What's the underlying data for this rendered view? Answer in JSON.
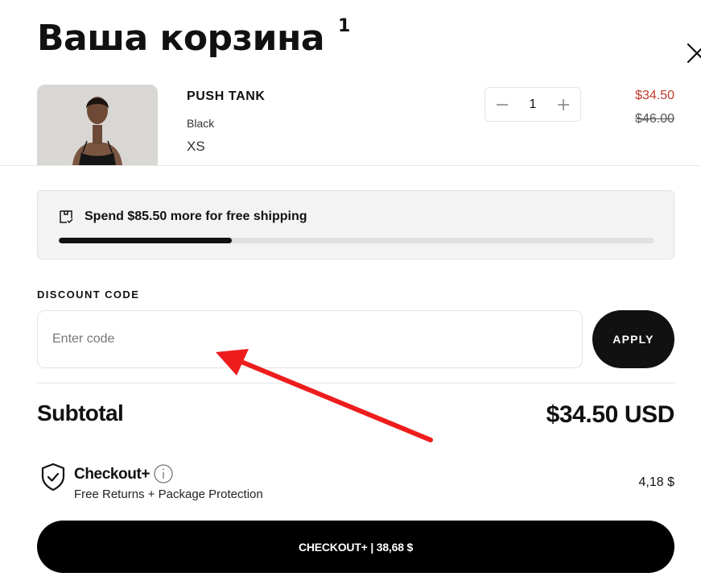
{
  "cart": {
    "title": "Ваша корзина",
    "count": "1"
  },
  "item": {
    "name": "PUSH TANK",
    "color": "Black",
    "size": "XS",
    "quantity": "1",
    "price_now": "$34.50",
    "price_was": "$46.00"
  },
  "shipping": {
    "message": "Spend $85.50 more for free shipping",
    "progress_percent": 29
  },
  "discount": {
    "label": "DISCOUNT CODE",
    "placeholder": "Enter code",
    "value": "",
    "apply_label": "APPLY"
  },
  "subtotal": {
    "label": "Subtotal",
    "value": "$34.50 USD"
  },
  "checkout_plus": {
    "name": "Checkout+",
    "description": "Free Returns + Package Protection",
    "price": "4,18 $"
  },
  "checkout_button": {
    "label": "CHECKOUT+ | 38,68 $"
  },
  "colors": {
    "accent": "#111111",
    "sale_price": "#c0392b",
    "annotation_arrow": "#ee1c1c"
  },
  "icons": {
    "close": "close-icon",
    "minus": "minus-icon",
    "plus": "plus-icon",
    "shipping": "shipping-box-icon",
    "shield": "shield-check-icon",
    "info": "info-icon"
  }
}
